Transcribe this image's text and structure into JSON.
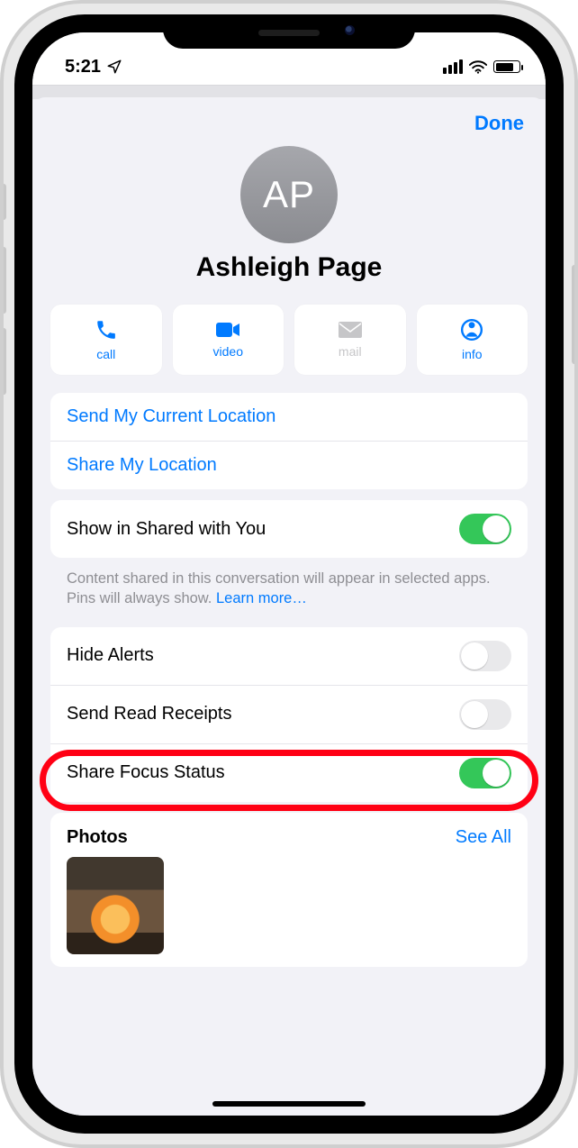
{
  "status": {
    "time": "5:21",
    "location_icon": "location-arrow"
  },
  "header": {
    "done": "Done"
  },
  "contact": {
    "initials": "AP",
    "name": "Ashleigh Page"
  },
  "actions": {
    "call": "call",
    "video": "video",
    "mail": "mail",
    "info": "info"
  },
  "location": {
    "send_current": "Send My Current Location",
    "share": "Share My Location"
  },
  "shared_with_you": {
    "label": "Show in Shared with You",
    "on": true,
    "footer": "Content shared in this conversation will appear in selected apps. Pins will always show. ",
    "learn_more": "Learn more…"
  },
  "toggles": {
    "hide_alerts": {
      "label": "Hide Alerts",
      "on": false
    },
    "send_read_receipts": {
      "label": "Send Read Receipts",
      "on": false
    },
    "share_focus_status": {
      "label": "Share Focus Status",
      "on": true
    }
  },
  "photos": {
    "title": "Photos",
    "see_all": "See All"
  }
}
